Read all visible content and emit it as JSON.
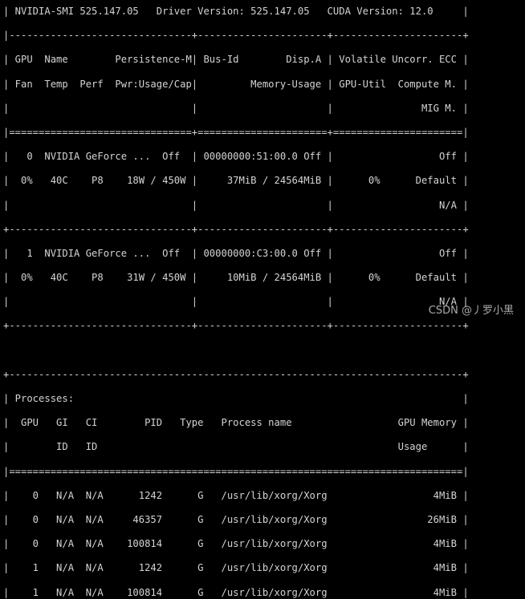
{
  "colors": {
    "background": "#000000",
    "text": "#d4d4d4",
    "watermark": "#c8c8c8"
  },
  "terminal": {
    "lines": [
      "| NVIDIA-SMI 525.147.05   Driver Version: 525.147.05   CUDA Version: 12.0     |",
      "|-------------------------------+----------------------+----------------------+",
      "| GPU  Name        Persistence-M| Bus-Id        Disp.A | Volatile Uncorr. ECC |",
      "| Fan  Temp  Perf  Pwr:Usage/Cap|         Memory-Usage | GPU-Util  Compute M. |",
      "|                               |                      |               MIG M. |",
      "|===============================+======================+======================|",
      "|   0  NVIDIA GeForce ...  Off  | 00000000:51:00.0 Off |                  Off |",
      "|  0%   40C    P8    18W / 450W |     37MiB / 24564MiB |      0%      Default |",
      "|                               |                      |                  N/A |",
      "+-------------------------------+----------------------+----------------------+",
      "|   1  NVIDIA GeForce ...  Off  | 00000000:C3:00.0 Off |                  Off |",
      "|  0%   40C    P8    31W / 450W |     10MiB / 24564MiB |      0%      Default |",
      "|                               |                      |                  N/A |",
      "+-------------------------------+----------------------+----------------------+",
      "",
      "+-----------------------------------------------------------------------------+",
      "| Processes:                                                                  |",
      "|  GPU   GI   CI        PID   Type   Process name                  GPU Memory |",
      "|        ID   ID                                                   Usage      |",
      "|=============================================================================|",
      "|    0   N/A  N/A      1242      G   /usr/lib/xorg/Xorg                  4MiB |",
      "|    0   N/A  N/A     46357      G   /usr/lib/xorg/Xorg                 26MiB |",
      "|    0   N/A  N/A    100814      G   /usr/lib/xorg/Xorg                  4MiB |",
      "|    1   N/A  N/A      1242      G   /usr/lib/xorg/Xorg                  4MiB |",
      "|    1   N/A  N/A    100814      G   /usr/lib/xorg/Xorg                  4MiB |"
    ]
  },
  "watermark": {
    "text": "CSDN @丿罗小黑"
  }
}
